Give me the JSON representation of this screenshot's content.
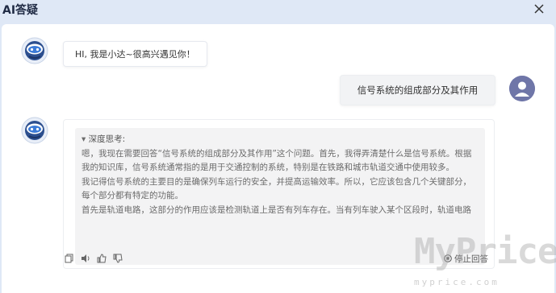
{
  "window": {
    "title": "AI答疑",
    "close_icon": "close-icon"
  },
  "colors": {
    "background": "#dfe8f6",
    "bot_avatar_ring": "#3b6fb6",
    "user_avatar": "#6f76a8",
    "think_box": "#f3f3f4"
  },
  "messages": {
    "greeting": "HI, 我是小达~很高兴遇见你！",
    "user_question": "信号系统的组成部分及其作用",
    "thinking": {
      "title": "深度思考:",
      "paragraphs": [
        "嗯，我现在需要回答“信号系统的组成部分及其作用”这个问题。首先，我得弄清楚什么是信号系统。根据我的知识库，信号系统通常指的是用于交通控制的系统，特别是在铁路和城市轨道交通中使用较多。",
        "我记得信号系统的主要目的是确保列车运行的安全，并提高运输效率。所以，它应该包含几个关键部分，每个部分都有特定的功能。",
        "首先是轨道电路，这部分的作用应该是检测轨道上是否有列车存在。当有列车驶入某个区段时，轨道电路"
      ]
    }
  },
  "actions": {
    "icons": [
      "copy-icon",
      "speaker-icon",
      "thumbs-up-icon",
      "thumbs-down-icon"
    ],
    "stop_label": "停止回答"
  },
  "watermark": {
    "text": "MyPrice",
    "subtext": "myprice.com"
  }
}
